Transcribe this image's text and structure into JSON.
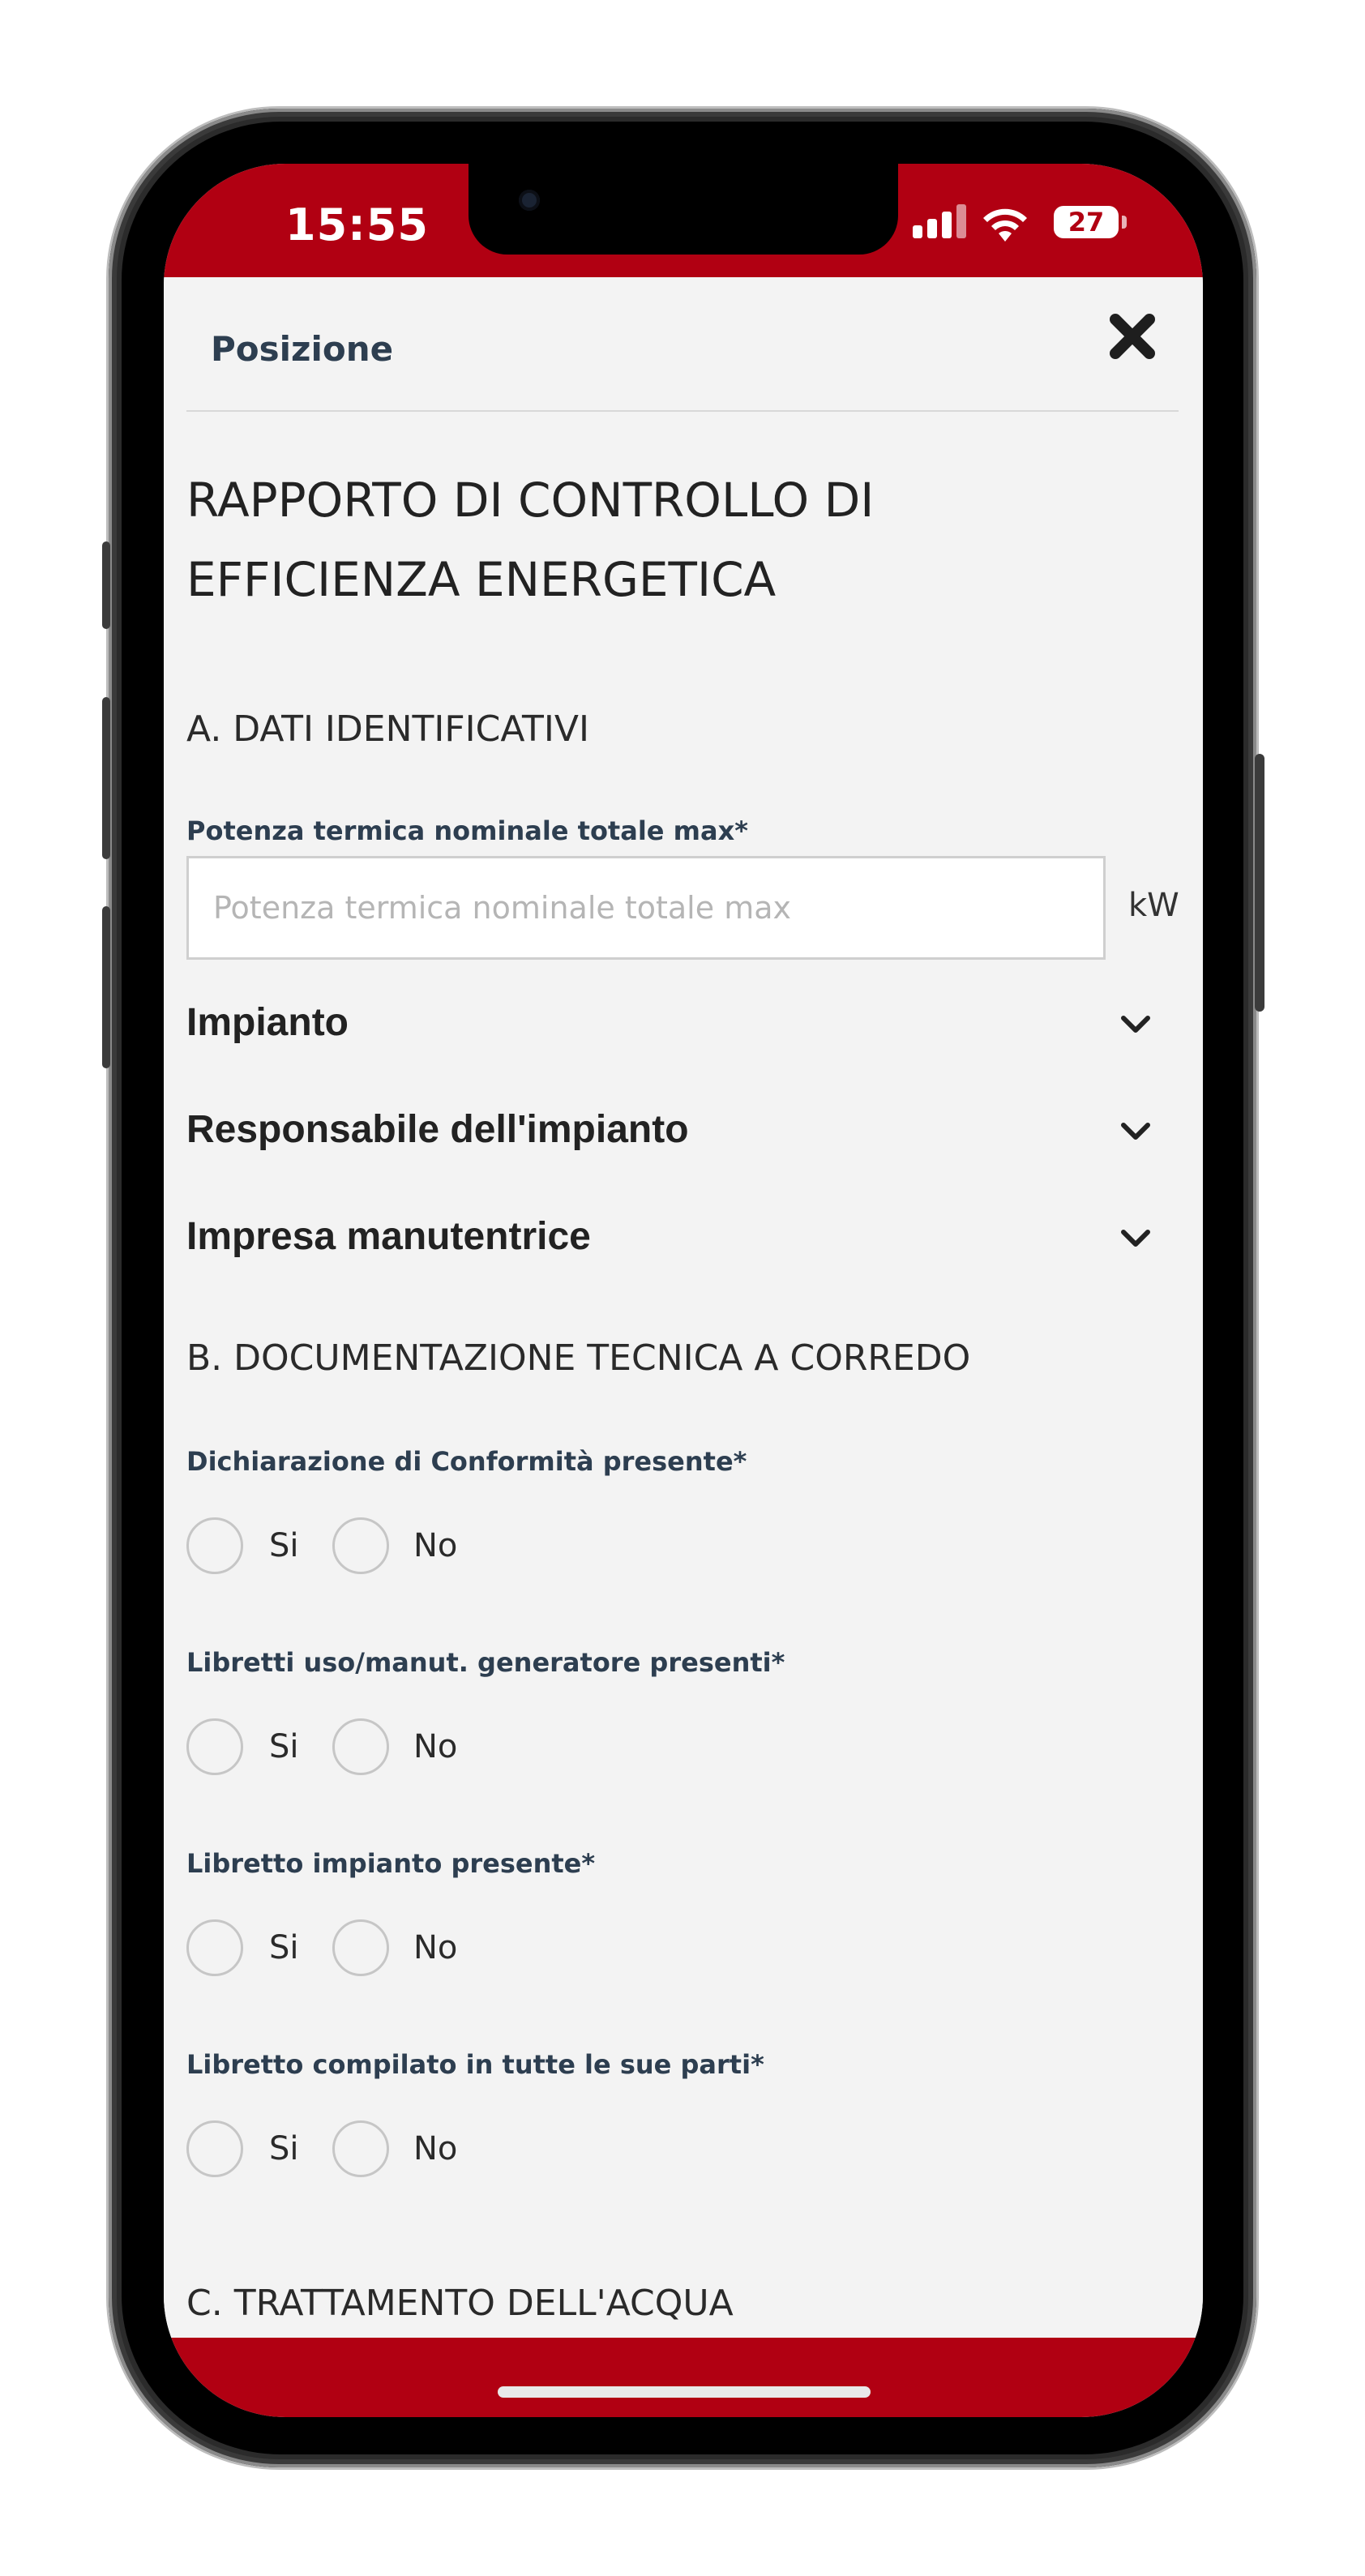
{
  "status_bar": {
    "time": "15:55",
    "battery": "27"
  },
  "modal": {
    "title": "Posizione"
  },
  "page": {
    "title": "RAPPORTO DI CONTROLLO DI EFFICIENZA ENERGETICA"
  },
  "section_a": {
    "title": "A. DATI IDENTIFICATIVI",
    "power_field": {
      "label": "Potenza termica nominale totale max*",
      "placeholder": "Potenza termica nominale totale max",
      "value": "",
      "unit": "kW"
    },
    "accordions": [
      {
        "label": "Impianto"
      },
      {
        "label": "Responsabile dell'impianto"
      },
      {
        "label": "Impresa manutentrice"
      }
    ]
  },
  "section_b": {
    "title": "B. DOCUMENTAZIONE TECNICA A CORREDO",
    "questions": [
      {
        "label": "Dichiarazione di Conformità presente*",
        "yes": "Si",
        "no": "No",
        "selected": null
      },
      {
        "label": "Libretti uso/manut. generatore presenti*",
        "yes": "Si",
        "no": "No",
        "selected": null
      },
      {
        "label": "Libretto impianto presente*",
        "yes": "Si",
        "no": "No",
        "selected": null
      },
      {
        "label": "Libretto compilato in tutte le sue parti*",
        "yes": "Si",
        "no": "No",
        "selected": null
      }
    ]
  },
  "section_c": {
    "title": "C. TRATTAMENTO DELL'ACQUA"
  },
  "colors": {
    "brand": "#b10012",
    "label": "#2d3e50",
    "background": "#f3f3f3"
  }
}
